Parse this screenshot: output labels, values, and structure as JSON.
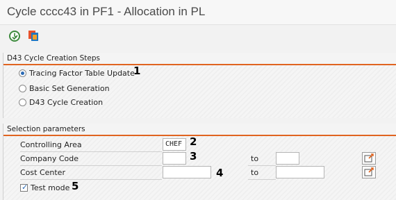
{
  "window": {
    "title": "Cycle cccc43 in PF1 - Allocation in PL"
  },
  "toolbar": {
    "execute_icon": "execute-clock-icon",
    "variant_icon": "get-variant-icon"
  },
  "steps_section": {
    "title": "D43 Cycle Creation Steps",
    "options": [
      {
        "label": "Tracing Factor Table Update",
        "selected": true,
        "marker": "1"
      },
      {
        "label": "Basic Set Generation",
        "selected": false
      },
      {
        "label": "D43 Cycle Creation",
        "selected": false
      }
    ]
  },
  "selection_section": {
    "title": "Selection parameters",
    "controlling_area": {
      "label": "Controlling Area",
      "value": "CHEF",
      "marker": "2"
    },
    "company_code": {
      "label": "Company Code",
      "value": "",
      "to_label": "to",
      "to_value": "",
      "marker": "3"
    },
    "cost_center": {
      "label": "Cost Center",
      "value": "",
      "to_label": "to",
      "to_value": "",
      "marker": "4"
    },
    "test_mode": {
      "label": "Test mode",
      "checked": true,
      "marker": "5"
    }
  },
  "colors": {
    "section_accent": "#e06420",
    "radio_dot": "#2a6ab4"
  }
}
